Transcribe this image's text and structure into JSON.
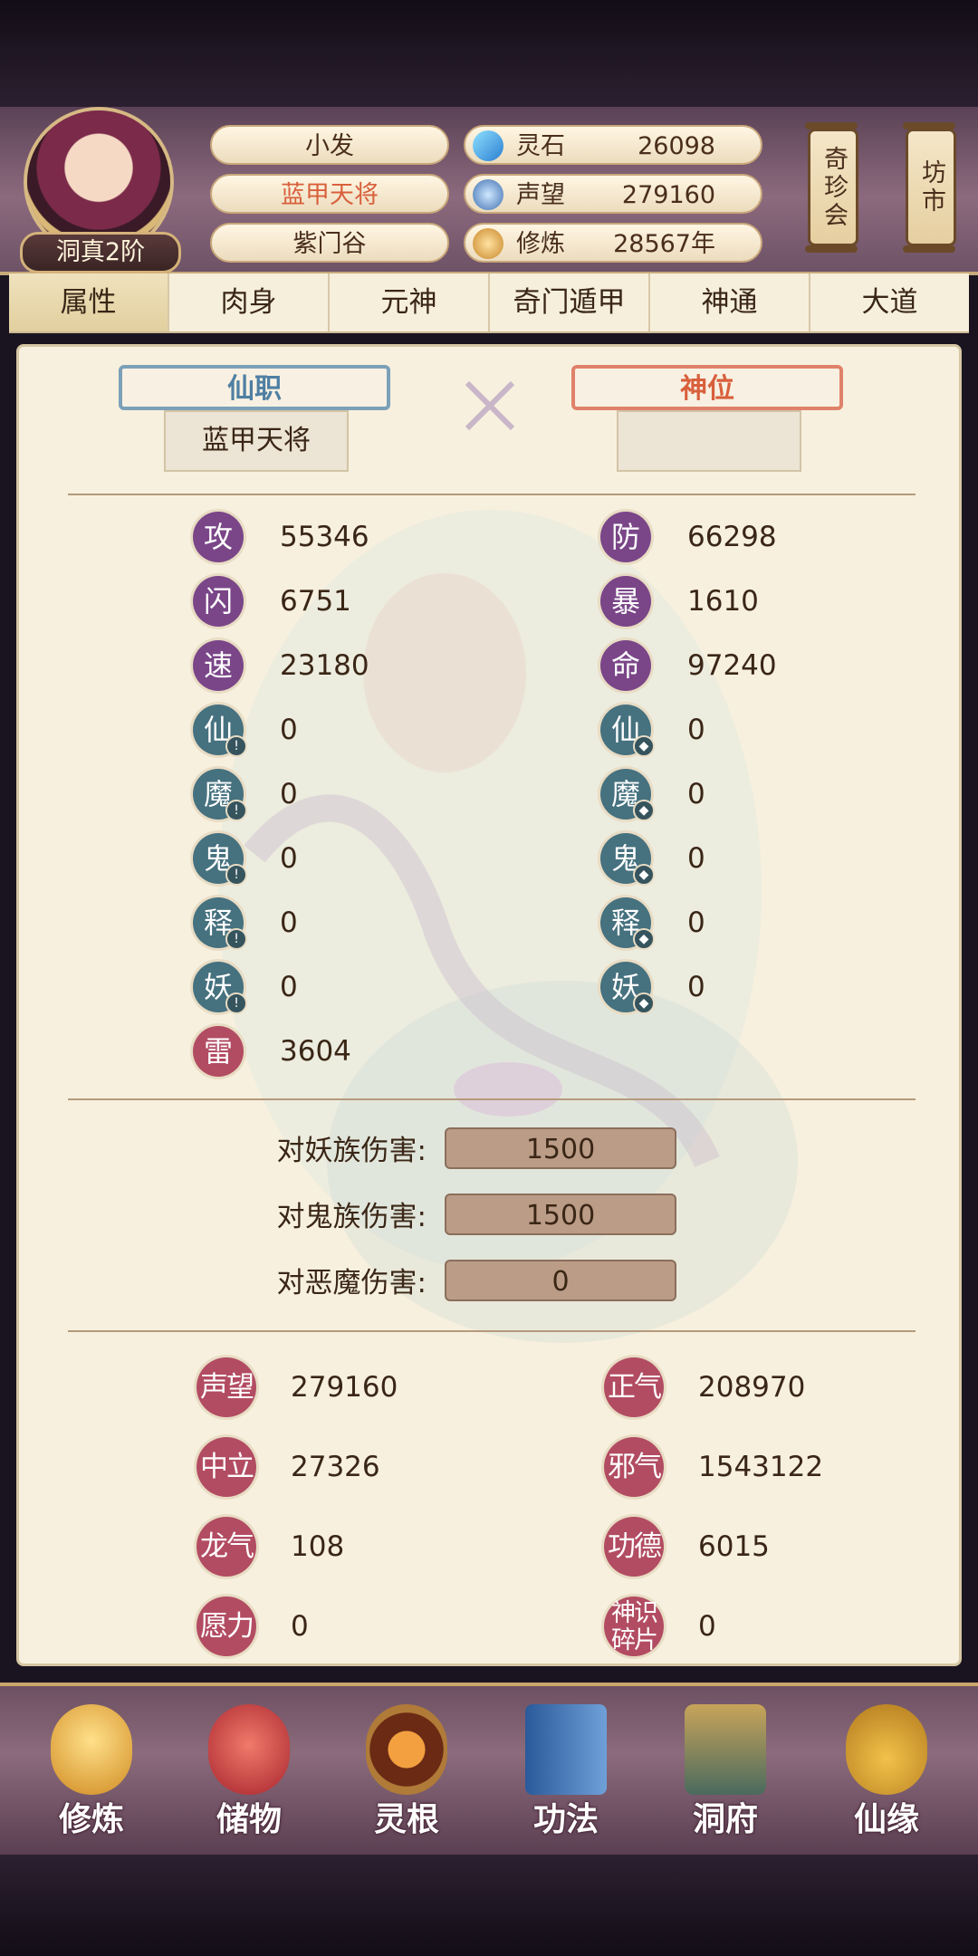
{
  "header": {
    "rank": "洞真2阶",
    "name": "小发",
    "title": "蓝甲天将",
    "sect": "紫门谷",
    "stats": [
      {
        "label": "灵石",
        "value": "26098",
        "icon": "spirit-stone-icon"
      },
      {
        "label": "声望",
        "value": "279160",
        "icon": "prestige-icon"
      },
      {
        "label": "修炼",
        "value": "28567年",
        "icon": "cultivation-icon"
      }
    ],
    "buttons": {
      "treasure": "奇珍会",
      "market": "坊市"
    }
  },
  "tabs": [
    "属性",
    "肉身",
    "元神",
    "奇门遁甲",
    "神通",
    "大道"
  ],
  "offices": {
    "immortal_label": "仙职",
    "immortal_value": "蓝甲天将",
    "divine_label": "神位",
    "divine_value": ""
  },
  "attributes": {
    "left": [
      {
        "label": "攻",
        "value": "55346"
      },
      {
        "label": "闪",
        "value": "6751"
      },
      {
        "label": "速",
        "value": "23180"
      },
      {
        "label": "仙",
        "value": "0"
      },
      {
        "label": "魔",
        "value": "0"
      },
      {
        "label": "鬼",
        "value": "0"
      },
      {
        "label": "释",
        "value": "0"
      },
      {
        "label": "妖",
        "value": "0"
      },
      {
        "label": "雷",
        "value": "3604"
      }
    ],
    "right": [
      {
        "label": "防",
        "value": "66298"
      },
      {
        "label": "暴",
        "value": "1610"
      },
      {
        "label": "命",
        "value": "97240"
      },
      {
        "label": "仙",
        "value": "0"
      },
      {
        "label": "魔",
        "value": "0"
      },
      {
        "label": "鬼",
        "value": "0"
      },
      {
        "label": "释",
        "value": "0"
      },
      {
        "label": "妖",
        "value": "0"
      }
    ]
  },
  "damage": [
    {
      "label": "对妖族伤害:",
      "value": "1500"
    },
    {
      "label": "对鬼族伤害:",
      "value": "1500"
    },
    {
      "label": "对恶魔伤害:",
      "value": "0"
    }
  ],
  "reputation": {
    "left": [
      {
        "label": "声望",
        "value": "279160"
      },
      {
        "label": "中立",
        "value": "27326"
      },
      {
        "label": "龙气",
        "value": "108"
      },
      {
        "label": "愿力",
        "value": "0"
      }
    ],
    "right": [
      {
        "label": "正气",
        "value": "208970"
      },
      {
        "label": "邪气",
        "value": "1543122"
      },
      {
        "label": "功德",
        "value": "6015"
      },
      {
        "label": "神识碎片",
        "value": "0"
      }
    ]
  },
  "bottom_nav": [
    {
      "label": "修炼",
      "icon": "cultivate-icon"
    },
    {
      "label": "储物",
      "icon": "storage-bag-icon"
    },
    {
      "label": "灵根",
      "icon": "spirit-root-icon"
    },
    {
      "label": "功法",
      "icon": "technique-book-icon"
    },
    {
      "label": "洞府",
      "icon": "cave-house-icon"
    },
    {
      "label": "仙缘",
      "icon": "destiny-gourd-icon"
    }
  ],
  "colors": {
    "accent_purple": "#7a4688",
    "accent_teal": "#46717f",
    "accent_red": "#b24c62",
    "title_orange": "#d8603c"
  }
}
